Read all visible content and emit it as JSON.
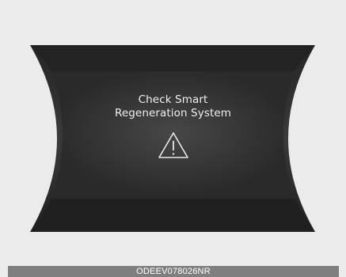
{
  "display": {
    "message_line1": "Check Smart",
    "message_line2": "Regeneration System",
    "icon": "warning-triangle-icon"
  },
  "caption": {
    "code": "ODEEV078026NR"
  },
  "colors": {
    "page_background": "#ebebeb",
    "panel_dark": "#1e1e1e",
    "panel_mid": "#3a3a3a",
    "text": "#f0f0f0",
    "caption_bar": "#7f7f7f"
  }
}
